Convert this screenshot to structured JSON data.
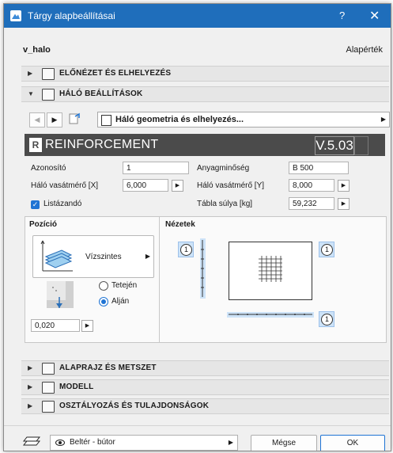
{
  "window": {
    "title": "Tárgy alapbeállításai",
    "help": "?",
    "close": "✕"
  },
  "header": {
    "object_name": "v_halo",
    "defaults_label": "Alapérték"
  },
  "sections": {
    "preview": "ELŐNÉZET ÉS ELHELYEZÉS",
    "mesh": "HÁLÓ BEÁLLÍTÁSOK",
    "plan": "ALAPRAJZ ÉS METSZET",
    "model": "MODELL",
    "classification": "OSZTÁLYOZÁS ÉS TULAJDONSÁGOK"
  },
  "page_select": {
    "label": "Háló geometria és elhelyezés..."
  },
  "banner": {
    "logo": "R",
    "title": "REINFORCEMENT",
    "version": "V.5.03"
  },
  "fields": {
    "azonosito_label": "Azonosító",
    "azonosito_value": "1",
    "anyag_label": "Anyagminőség",
    "anyag_value": "B 500",
    "x_label": "Háló vasátmérő [X]",
    "x_value": "6,000",
    "y_label": "Háló vasátmérő [Y]",
    "y_value": "8,000",
    "list_label": "Listázandó",
    "list_checked": true,
    "weight_label": "Tábla súlya [kg]",
    "weight_value": "59,232"
  },
  "position": {
    "title": "Pozíció",
    "orientation": "Vízszintes",
    "top_label": "Tetején",
    "bottom_label": "Alján",
    "selected": "bottom",
    "offset_value": "0,020"
  },
  "views": {
    "title": "Nézetek",
    "marker": "1"
  },
  "footer": {
    "layer": "Beltér - bútor",
    "cancel": "Mégse",
    "ok": "OK"
  },
  "colors": {
    "titlebar": "#1f6ebb",
    "accent": "#1f74d4",
    "banner": "#4b4b4b"
  }
}
